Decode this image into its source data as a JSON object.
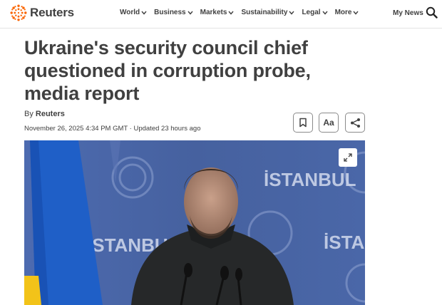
{
  "header": {
    "logo_text": "Reuters",
    "nav": [
      {
        "label": "World"
      },
      {
        "label": "Business"
      },
      {
        "label": "Markets"
      },
      {
        "label": "Sustainability"
      },
      {
        "label": "Legal"
      },
      {
        "label": "More"
      }
    ],
    "my_news": "My News",
    "accent_color": "#fa6400"
  },
  "article": {
    "headline": "Ukraine's security council chief questioned in corruption probe, media report",
    "byline_prefix": "By",
    "author": "Reuters",
    "dateline": "November 26, 2025 4:34 PM GMT · Updated 23 hours ago",
    "font_button": "Aa"
  },
  "photo": {
    "backdrop_text_1": "İSTANBUL",
    "backdrop_text_2": "İSTANBUL",
    "backdrop_text_3": "İSTA"
  },
  "icons": [
    "reuters-logo-icon",
    "chevron-down-icon",
    "search-icon",
    "bookmark-icon",
    "share-icon",
    "expand-icon"
  ]
}
